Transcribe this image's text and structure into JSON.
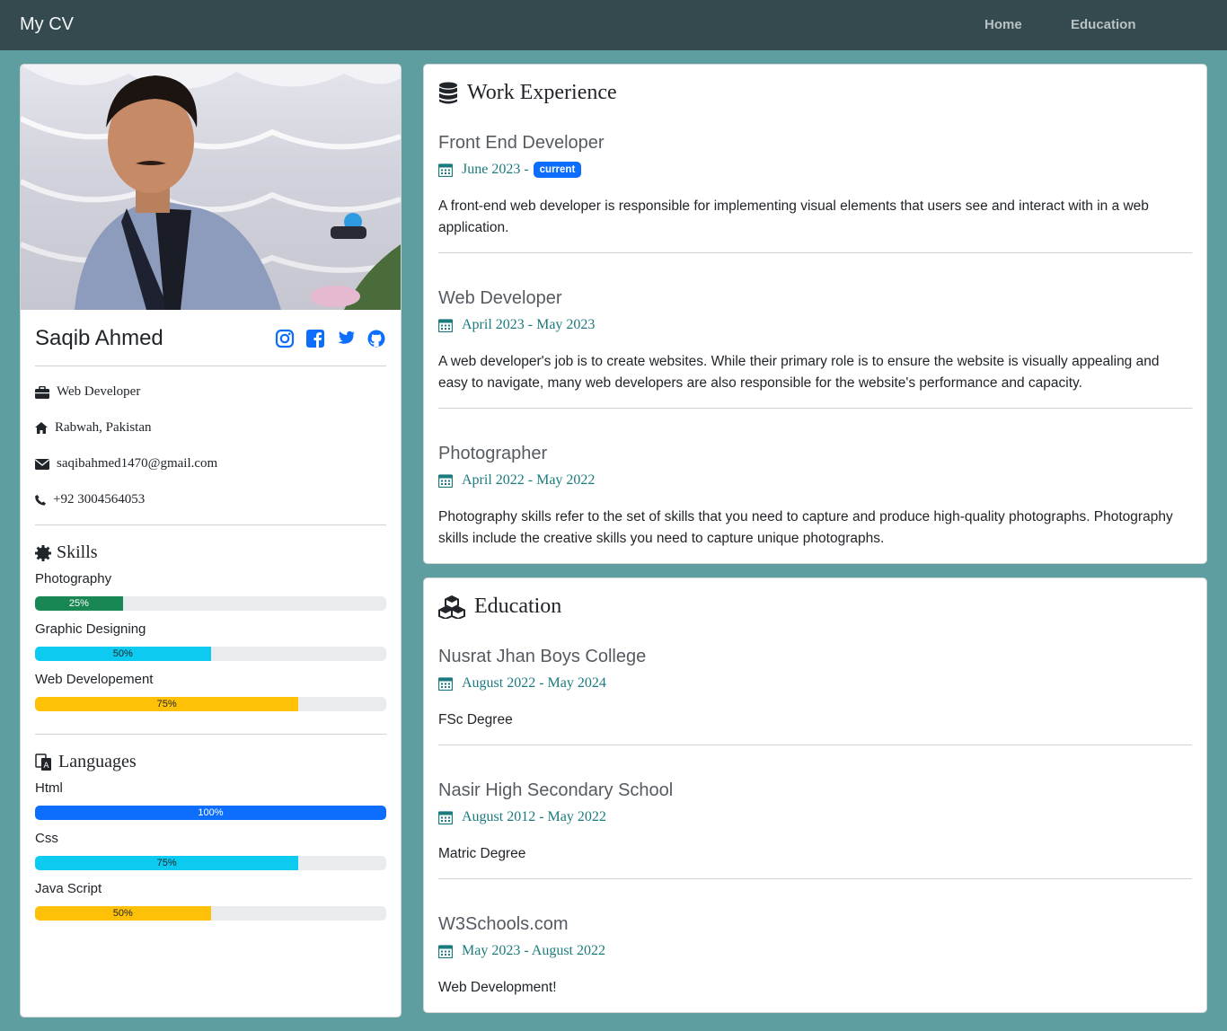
{
  "nav": {
    "brand": "My CV",
    "links": [
      "Home",
      "Education"
    ]
  },
  "profile": {
    "name": "Saqib Ahmed",
    "socials": [
      "instagram-icon",
      "facebook-icon",
      "twitter-icon",
      "github-icon"
    ],
    "info": {
      "job": "Web Developer",
      "location": "Rabwah, Pakistan",
      "email": "saqibahmed1470@gmail.com",
      "phone": "+92 3004564053"
    },
    "skills_title": "Skills",
    "skills": [
      {
        "label": "Photography",
        "percent": 25,
        "text": "25%",
        "color": "#198754"
      },
      {
        "label": "Graphic Designing",
        "percent": 50,
        "text": "50%",
        "color": "#0dcaf0"
      },
      {
        "label": "Web Developement",
        "percent": 75,
        "text": "75%",
        "color": "#ffc107"
      }
    ],
    "languages_title": "Languages",
    "languages": [
      {
        "label": "Html",
        "percent": 100,
        "text": "100%",
        "color": "#0d6efd"
      },
      {
        "label": "Css",
        "percent": 75,
        "text": "75%",
        "color": "#0dcaf0"
      },
      {
        "label": "Java Script",
        "percent": 50,
        "text": "50%",
        "color": "#ffc107"
      }
    ]
  },
  "work": {
    "title": "Work Experience",
    "badge": "current",
    "entries": [
      {
        "title": "Front End Developer",
        "date": "June 2023 -",
        "desc": "A front-end web developer is responsible for implementing visual elements that users see and interact with in a web application."
      },
      {
        "title": "Web Developer",
        "date": "April 2023 - May 2023",
        "desc": "A web developer's job is to create websites. While their primary role is to ensure the website is visually appealing and easy to navigate, many web developers are also responsible for the website's performance and capacity."
      },
      {
        "title": "Photographer",
        "date": "April 2022 - May 2022",
        "desc": "Photography skills refer to the set of skills that you need to capture and produce high-quality photographs. Photography skills include the creative skills you need to capture unique photographs."
      }
    ]
  },
  "education": {
    "title": "Education",
    "entries": [
      {
        "title": "Nusrat Jhan Boys College",
        "date": "August 2022 - May 2024",
        "desc": "FSc Degree"
      },
      {
        "title": "Nasir High Secondary School",
        "date": "August 2012 - May 2022",
        "desc": "Matric Degree"
      },
      {
        "title": "W3Schools.com",
        "date": "May 2023 - August 2022",
        "desc": "Web Development!"
      }
    ]
  }
}
